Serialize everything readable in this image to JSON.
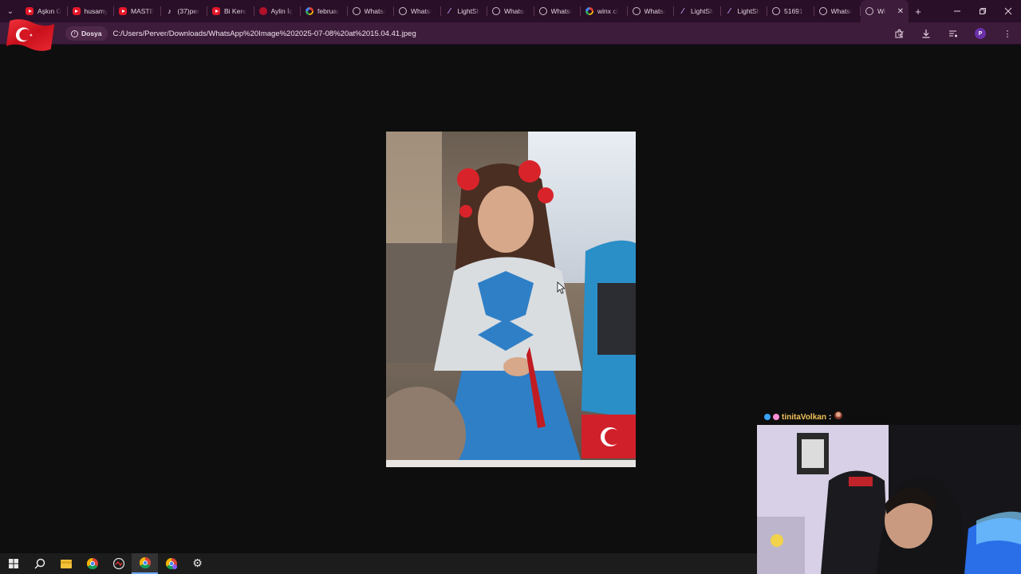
{
  "browser": {
    "tabs": [
      {
        "title": "Aşkın G",
        "icon": "youtube-icon",
        "active": false
      },
      {
        "title": "husamy",
        "icon": "youtube-icon",
        "active": false
      },
      {
        "title": "MASTE",
        "icon": "youtube-icon",
        "active": false
      },
      {
        "title": "(37)per",
        "icon": "tiktok-icon",
        "active": false
      },
      {
        "title": "Bi Kere",
        "icon": "youtube-icon",
        "active": false
      },
      {
        "title": "Aylin İç",
        "icon": "red-app-icon",
        "active": false
      },
      {
        "title": "februar",
        "icon": "google-icon",
        "active": false
      },
      {
        "title": "Whats/",
        "icon": "globe-icon",
        "active": false
      },
      {
        "title": "Whats/",
        "icon": "globe-icon",
        "active": false
      },
      {
        "title": "LightSh",
        "icon": "lightshot-icon",
        "active": false
      },
      {
        "title": "Whats/",
        "icon": "globe-icon",
        "active": false
      },
      {
        "title": "Whats/",
        "icon": "globe-icon",
        "active": false
      },
      {
        "title": "winx cl",
        "icon": "google-icon",
        "active": false
      },
      {
        "title": "Whats/",
        "icon": "globe-icon",
        "active": false
      },
      {
        "title": "LightSh",
        "icon": "lightshot-icon",
        "active": false
      },
      {
        "title": "LightSh",
        "icon": "lightshot-icon",
        "active": false
      },
      {
        "title": "51691",
        "icon": "globe-icon",
        "active": false
      },
      {
        "title": "Whats/",
        "icon": "globe-icon",
        "active": false
      },
      {
        "title": "Wł",
        "icon": "globe-icon",
        "active": true
      }
    ],
    "address": {
      "scheme_label": "Dosya",
      "url": "C:/Users/Perver/Downloads/WhatsApp%20Image%202025-07-08%20at%2015.04.41.jpeg"
    },
    "profile_initial": "P",
    "theme": {
      "tabstrip": "#2a0f28",
      "toolbar": "#3d1b3a"
    }
  },
  "stream_overlay": {
    "chat_username": "tinitaVolkan",
    "chat_separator": ":"
  },
  "taskbar": {
    "items": [
      "windows-start-icon",
      "search-icon",
      "file-explorer-icon",
      "chrome-icon",
      "app-icon",
      "chrome-active-icon",
      "chrome-profile-icon",
      "settings-icon"
    ]
  }
}
